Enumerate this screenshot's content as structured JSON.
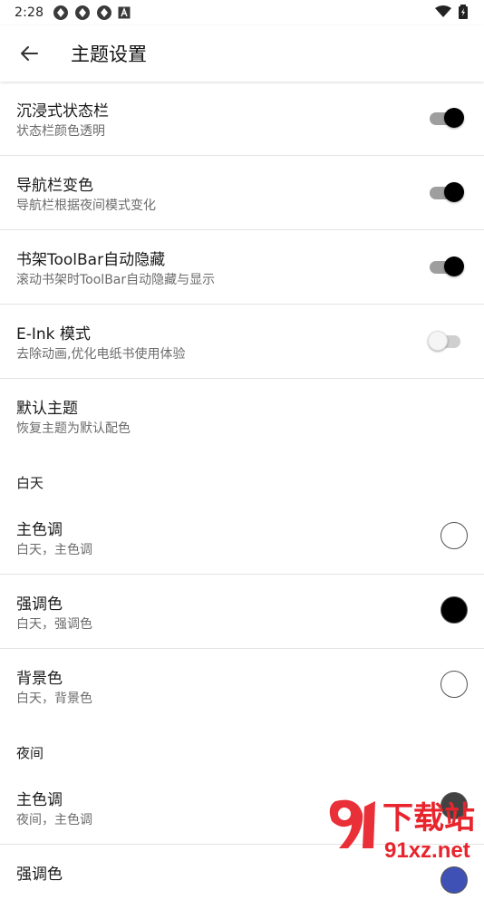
{
  "status": {
    "time": "2:28"
  },
  "header": {
    "title": "主题设置"
  },
  "switch_items": [
    {
      "title": "沉浸式状态栏",
      "subtitle": "状态栏颜色透明",
      "on": true
    },
    {
      "title": "导航栏变色",
      "subtitle": "导航栏根据夜间模式变化",
      "on": true
    },
    {
      "title": "书架ToolBar自动隐藏",
      "subtitle": "滚动书架时ToolBar自动隐藏与显示",
      "on": true
    },
    {
      "title": "E-Ink 模式",
      "subtitle": "去除动画,优化电纸书使用体验",
      "on": false
    }
  ],
  "default_theme": {
    "title": "默认主题",
    "subtitle": "恢复主题为默认配色"
  },
  "day": {
    "header": "白天",
    "items": [
      {
        "title": "主色调",
        "subtitle": "白天，主色调",
        "color": "#ffffff"
      },
      {
        "title": "强调色",
        "subtitle": "白天，强调色",
        "color": "#000000"
      },
      {
        "title": "背景色",
        "subtitle": "白天，背景色",
        "color": "#ffffff"
      }
    ]
  },
  "night": {
    "header": "夜间",
    "items": [
      {
        "title": "主色调",
        "subtitle": "夜间，主色调",
        "color": "#424242"
      },
      {
        "title": "强调色",
        "subtitle": "",
        "color": "#3f51b5"
      }
    ]
  },
  "watermark": {
    "text_main": "下载站",
    "text_url": "91xz.net"
  }
}
